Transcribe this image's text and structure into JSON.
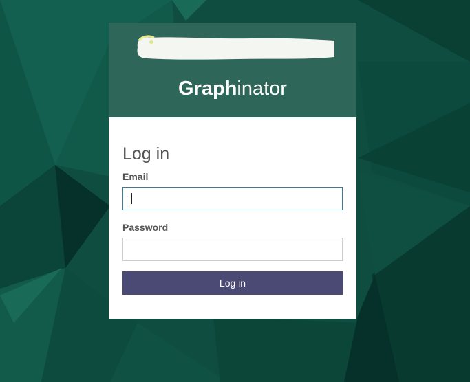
{
  "brand": {
    "name_bold": "Graph",
    "name_light": "inator"
  },
  "login": {
    "title": "Log in",
    "email_label": "Email",
    "email_value": "",
    "password_label": "Password",
    "password_value": "",
    "submit_label": "Log in"
  },
  "colors": {
    "background": "#0d4a3e",
    "header": "#00503f",
    "button": "#4b4a74",
    "focus_border": "#3c7b99"
  }
}
